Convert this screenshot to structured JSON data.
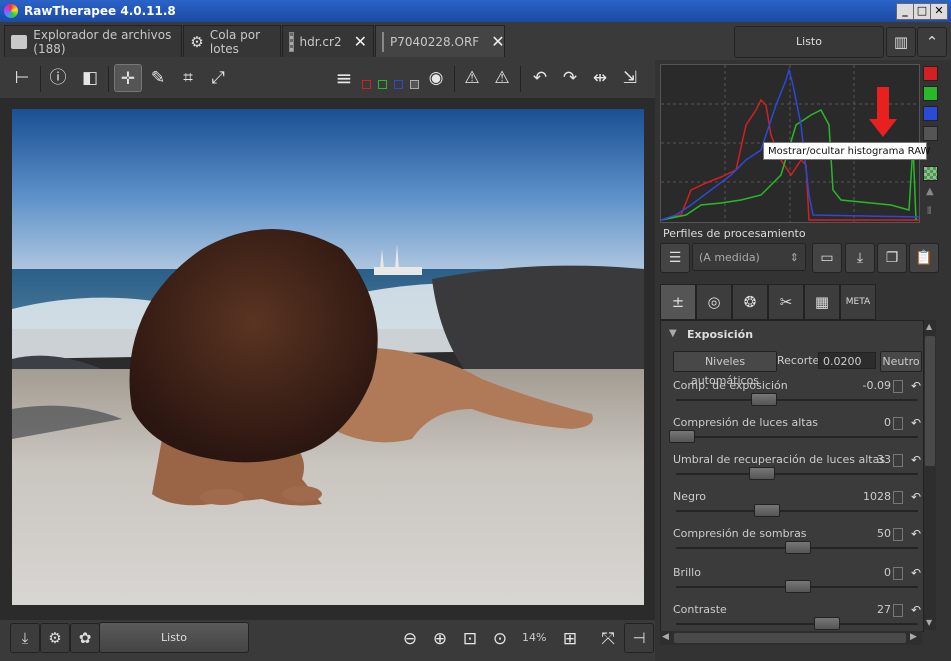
{
  "window": {
    "title": "RawTherapee 4.0.11.8",
    "controls": {
      "minimize": "_",
      "maximize": "□",
      "close": "✕"
    }
  },
  "tabs": [
    {
      "label": "Explorador de archivos (188)",
      "icon": "folder-icon"
    },
    {
      "label": "Cola por lotes",
      "icon": "gears-icon"
    },
    {
      "label": "hdr.cr2",
      "icon": "thumbnail-icon",
      "close": "✕"
    },
    {
      "label": "P7040228.ORF",
      "icon": "thumbnail-icon",
      "close": "✕"
    }
  ],
  "top_status": "Listo",
  "bottom_status": "Listo",
  "zoom": "14%",
  "tooltip": "Mostrar/ocultar histograma RAW",
  "profiles": {
    "label": "Perfiles de procesamiento",
    "selected": "(A medida)"
  },
  "exposure": {
    "title": "Exposición",
    "auto_levels": "Niveles automáticos",
    "clip_label": "Recorte",
    "clip_value": "0.0200",
    "neutral": "Neutro",
    "sliders": [
      {
        "label": "Comp. de exposición",
        "value": "-0.09",
        "position": 0.36
      },
      {
        "label": "Compresión de luces altas",
        "value": "0",
        "position": 0.02
      },
      {
        "label": "Umbral de recuperación de luces altas",
        "value": "33",
        "position": 0.35
      },
      {
        "label": "Negro",
        "value": "1028",
        "position": 0.37
      },
      {
        "label": "Compresión de sombras",
        "value": "50",
        "position": 0.5
      },
      {
        "label": "Brillo",
        "value": "0",
        "position": 0.5
      },
      {
        "label": "Contraste",
        "value": "27",
        "position": 0.62
      }
    ]
  },
  "colors": {
    "accent": "#2a63c8",
    "red": "#d42020",
    "green": "#2ab82a",
    "blue": "#2a4ad8"
  }
}
